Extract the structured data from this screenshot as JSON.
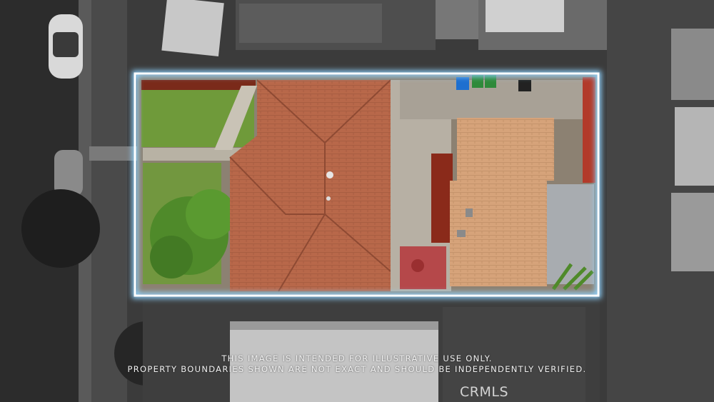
{
  "disclaimer": {
    "line1": "THIS IMAGE IS INTENDED FOR ILLUSTRATIVE USE ONLY.",
    "line2": "PROPERTY BOUNDARIES SHOWN ARE NOT EXACT AND SHOULD BE INDEPENDENTLY VERIFIED."
  },
  "watermark": "CRMLS",
  "colors": {
    "boundary": "#ffffff",
    "boundary_glow": "#8fd3ff",
    "roof_main": "#b8684a",
    "roof_garage": "#d6a37a",
    "lawn": "#6f9a3a"
  }
}
